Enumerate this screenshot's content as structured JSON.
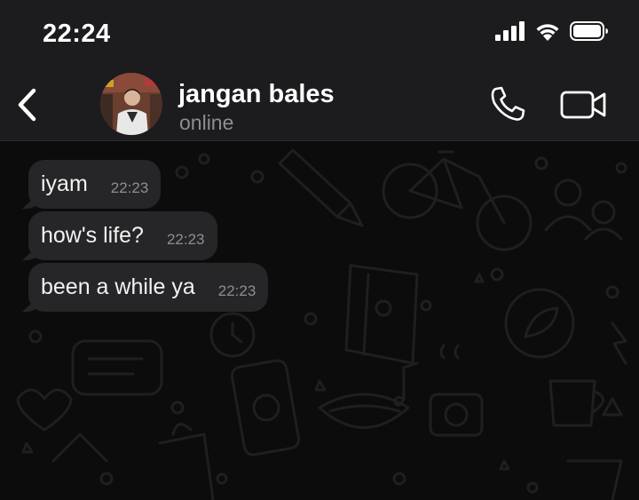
{
  "status_bar": {
    "time": "22:24",
    "icons": [
      "signal-icon",
      "wifi-icon",
      "battery-icon"
    ]
  },
  "header": {
    "back_icon": "chevron-left-icon",
    "contact_name": "jangan bales",
    "contact_status": "online",
    "call_icon": "phone-icon",
    "video_icon": "video-camera-icon"
  },
  "messages": [
    {
      "text": "iyam",
      "time": "22:23",
      "direction": "incoming"
    },
    {
      "text": "how's life?",
      "time": "22:23",
      "direction": "incoming"
    },
    {
      "text": "been a while ya",
      "time": "22:23",
      "direction": "incoming"
    }
  ],
  "colors": {
    "bar_background": "#1c1c1e",
    "bubble_incoming": "#262628",
    "chat_background": "#0c0c0c",
    "secondary_text": "#8e8e93"
  }
}
